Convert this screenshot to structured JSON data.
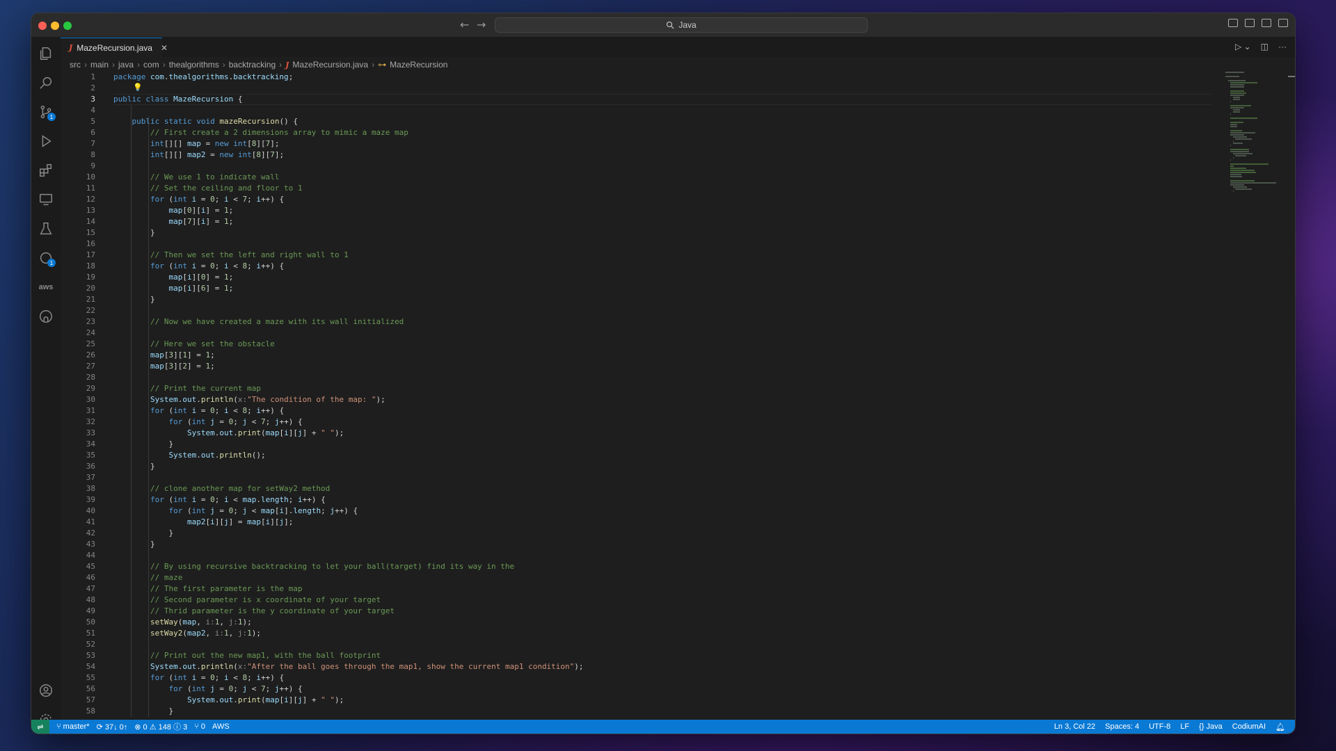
{
  "titlebar": {
    "search_text": "Java"
  },
  "tab": {
    "filename": "MazeRecursion.java",
    "icon": "java-file-icon"
  },
  "breadcrumbs": [
    "src",
    "main",
    "java",
    "com",
    "thealgorithms",
    "backtracking",
    "MazeRecursion.java",
    "MazeRecursion"
  ],
  "activity_badges": {
    "source_control": "1",
    "remote": "1",
    "settings": "1"
  },
  "editor": {
    "current_line": 3,
    "lines": [
      "package com.thealgorithms.backtracking;",
      "",
      "public class MazeRecursion {",
      "",
      "    public static void mazeRecursion() {",
      "        // First create a 2 dimensions array to mimic a maze map",
      "        int[][] map = new int[8][7];",
      "        int[][] map2 = new int[8][7];",
      "",
      "        // We use 1 to indicate wall",
      "        // Set the ceiling and floor to 1",
      "        for (int i = 0; i < 7; i++) {",
      "            map[0][i] = 1;",
      "            map[7][i] = 1;",
      "        }",
      "",
      "        // Then we set the left and right wall to 1",
      "        for (int i = 0; i < 8; i++) {",
      "            map[i][0] = 1;",
      "            map[i][6] = 1;",
      "        }",
      "",
      "        // Now we have created a maze with its wall initialized",
      "",
      "        // Here we set the obstacle",
      "        map[3][1] = 1;",
      "        map[3][2] = 1;",
      "",
      "        // Print the current map",
      "        System.out.println(x:\"The condition of the map: \");",
      "        for (int i = 0; i < 8; i++) {",
      "            for (int j = 0; j < 7; j++) {",
      "                System.out.print(map[i][j] + \" \");",
      "            }",
      "            System.out.println();",
      "        }",
      "",
      "        // clone another map for setWay2 method",
      "        for (int i = 0; i < map.length; i++) {",
      "            for (int j = 0; j < map[i].length; j++) {",
      "                map2[i][j] = map[i][j];",
      "            }",
      "        }",
      "",
      "        // By using recursive backtracking to let your ball(target) find its way in the",
      "        // maze",
      "        // The first parameter is the map",
      "        // Second parameter is x coordinate of your target",
      "        // Thrid parameter is the y coordinate of your target",
      "        setWay(map, i:1, j:1);",
      "        setWay2(map2, i:1, j:1);",
      "",
      "        // Print out the new map1, with the ball footprint",
      "        System.out.println(x:\"After the ball goes through the map1, show the current map1 condition\");",
      "        for (int i = 0; i < 8; i++) {",
      "            for (int j = 0; j < 7; j++) {",
      "                System.out.print(map[i][j] + \" \");",
      "            }"
    ]
  },
  "statusbar": {
    "branch": "master*",
    "sync": "37↓ 0↑",
    "errors": "0",
    "warnings": "148",
    "infos": "3",
    "ports": "0",
    "aws": "AWS",
    "cursor": "Ln 3, Col 22",
    "indent": "Spaces: 4",
    "encoding": "UTF-8",
    "eol": "LF",
    "language": "Java",
    "codium": "CodiumAI"
  }
}
